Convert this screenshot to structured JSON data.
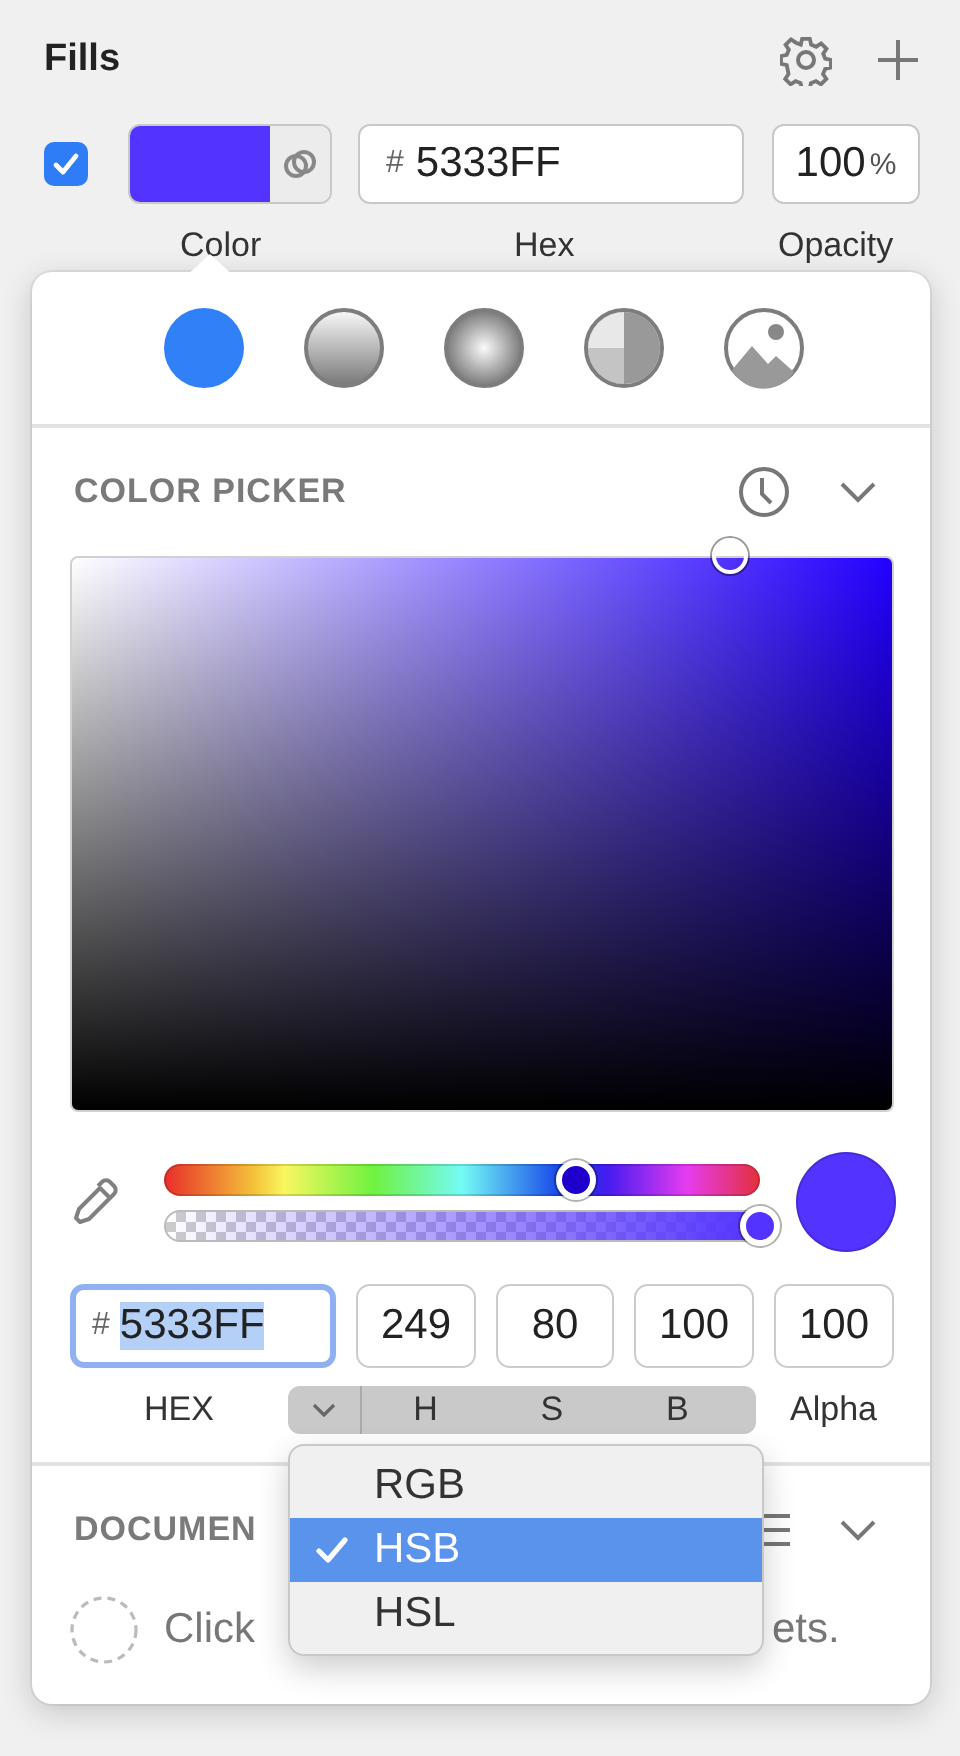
{
  "panel": {
    "title": "Fills"
  },
  "fill": {
    "enabled": true,
    "color": "#5333ff",
    "hex_prefix": "#",
    "hex": "5333FF",
    "opacity": "100",
    "opacity_unit": "%",
    "labels": [
      "Color",
      "Hex",
      "Opacity"
    ]
  },
  "fill_types": [
    {
      "kind": "solid",
      "selected": true
    },
    {
      "kind": "linear",
      "selected": false
    },
    {
      "kind": "radial",
      "selected": false
    },
    {
      "kind": "angular",
      "selected": false
    },
    {
      "kind": "image",
      "selected": false
    }
  ],
  "color_picker": {
    "title": "COLOR PICKER",
    "hue": {
      "level": 0.69
    },
    "alpha": {
      "level": 1
    },
    "hex_prefix": "#",
    "hex": "5333FF",
    "hex_focused": true,
    "hex_text_selected": true,
    "values": [
      "249",
      "80",
      "100",
      "100"
    ],
    "hex_label": "HEX",
    "mode_labels": [
      "H",
      "S",
      "B"
    ],
    "alpha_label": "Alpha"
  },
  "documents": {
    "title": "DOCUMEN",
    "hint_start": "Click",
    "hint_end": "ets."
  },
  "mode_menu": [
    {
      "label": "RGB",
      "selected": false
    },
    {
      "label": "HSB",
      "selected": true
    },
    {
      "label": "HSL",
      "selected": false
    }
  ]
}
